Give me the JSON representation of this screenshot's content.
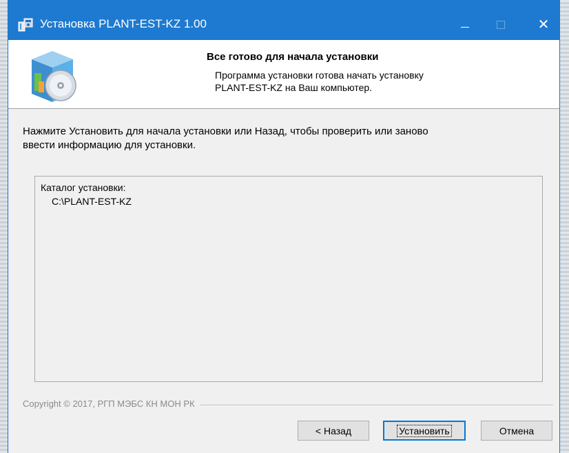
{
  "window": {
    "title": "Установка PLANT-EST-KZ 1.00",
    "accent_color": "#1e7ad0",
    "controls": {
      "minimize_icon": "minimize-icon",
      "maximize_icon": "maximize-icon",
      "close_glyph": "✕"
    }
  },
  "header": {
    "title": "Все готово для начала установки",
    "subtitle_line1": "Программа установки готова начать установку",
    "subtitle_line2": "PLANT-EST-KZ на Ваш компьютер."
  },
  "body": {
    "instruction_line1": "Нажмите Установить для начала установки или Назад, чтобы проверить или заново",
    "instruction_line2": "ввести информацию для установки.",
    "info_label": "Каталог установки:",
    "info_value": "C:\\PLANT-EST-KZ"
  },
  "footer": {
    "copyright": "Copyright © 2017, РГП МЭБС КН МОН РК"
  },
  "buttons": {
    "back": "< Назад",
    "install": "Установить",
    "cancel": "Отмена"
  }
}
